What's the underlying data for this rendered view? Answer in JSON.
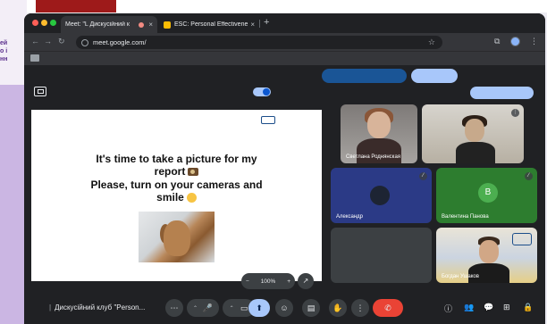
{
  "background": {
    "left_snippet": [
      "ей",
      "о і",
      "нн"
    ]
  },
  "browser": {
    "tabs": [
      {
        "title": "Meet: \"L Дискусійний к",
        "active": true
      },
      {
        "title": "ESC: Personal Effectivene",
        "active": false
      }
    ],
    "tab_close": "×",
    "new_tab": "+",
    "url": "meet.google.com/",
    "icons": {
      "back": "←",
      "forward": "→",
      "reload": "↻",
      "star": "☆",
      "extensions": "⧉",
      "menu": "⋮"
    }
  },
  "slide": {
    "line1": "It's time to take a picture for my",
    "line2": "report",
    "line3": "Please, turn on your cameras and",
    "line4": "smile"
  },
  "zoom": {
    "minus": "−",
    "level": "100%",
    "plus": "+"
  },
  "participants": [
    {
      "name": "Светлана Роднянская"
    },
    {
      "name": ""
    },
    {
      "name": "Александр"
    },
    {
      "name": "Валентина Панова",
      "avatar_letter": "B"
    },
    {
      "name": ""
    },
    {
      "name": "Богдан Ушаков"
    }
  ],
  "meeting": {
    "name": "Дискусійний клуб \"Person...",
    "separator": "|"
  },
  "controls": {
    "more": "⋯",
    "mic": "🎤",
    "camera": "▭",
    "present": "⬆",
    "emoji": "☺",
    "captions": "▤",
    "raise_hand": "✋",
    "options": "⋮",
    "end_call": "✆"
  },
  "right_controls": {
    "info": "ⓘ",
    "people": "👥",
    "chat": "💬",
    "activities": "⊞",
    "host": "🔒"
  },
  "colors": {
    "meet_bg": "#202124",
    "end_call": "#ea4335",
    "accent_blue": "#a8c7fa"
  }
}
